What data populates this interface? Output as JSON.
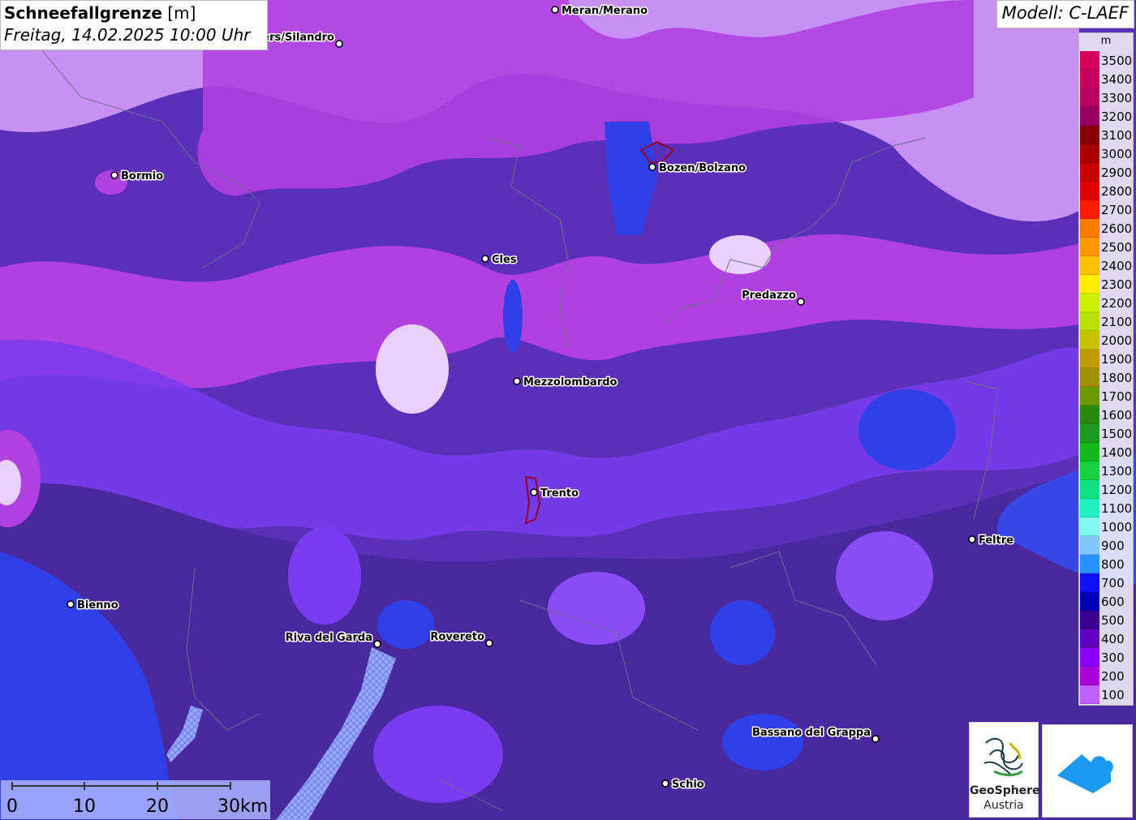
{
  "title": {
    "main_bold": "Schneefallgrenze",
    "main_unit": " [m]",
    "datetime": "Freitag, 14.02.2025 10:00 Uhr"
  },
  "model_label": "Modell: C-LAEF",
  "legend": {
    "unit": "m",
    "entries": [
      {
        "label": "3500",
        "color": "#d4005a"
      },
      {
        "label": "3400",
        "color": "#c8005e"
      },
      {
        "label": "3300",
        "color": "#b80064"
      },
      {
        "label": "3200",
        "color": "#9a0060"
      },
      {
        "label": "3100",
        "color": "#8a0000"
      },
      {
        "label": "3000",
        "color": "#a80000"
      },
      {
        "label": "2900",
        "color": "#c80000"
      },
      {
        "label": "2800",
        "color": "#e00000"
      },
      {
        "label": "2700",
        "color": "#ff1a00"
      },
      {
        "label": "2600",
        "color": "#ff7a00"
      },
      {
        "label": "2500",
        "color": "#ff9900"
      },
      {
        "label": "2400",
        "color": "#ffc000"
      },
      {
        "label": "2300",
        "color": "#ffee00"
      },
      {
        "label": "2200",
        "color": "#c8f000"
      },
      {
        "label": "2100",
        "color": "#b8e000"
      },
      {
        "label": "2000",
        "color": "#c8c000"
      },
      {
        "label": "1900",
        "color": "#c09a00"
      },
      {
        "label": "1800",
        "color": "#a09000"
      },
      {
        "label": "1700",
        "color": "#6a9a00"
      },
      {
        "label": "1600",
        "color": "#2a8a10"
      },
      {
        "label": "1500",
        "color": "#1a9a20"
      },
      {
        "label": "1400",
        "color": "#10b818"
      },
      {
        "label": "1300",
        "color": "#18d040"
      },
      {
        "label": "1200",
        "color": "#10e080"
      },
      {
        "label": "1100",
        "color": "#20f0c0"
      },
      {
        "label": "1000",
        "color": "#80f8f0"
      },
      {
        "label": "900",
        "color": "#80c8ff"
      },
      {
        "label": "800",
        "color": "#2890ff"
      },
      {
        "label": "700",
        "color": "#1010ff"
      },
      {
        "label": "600",
        "color": "#0000b8"
      },
      {
        "label": "500",
        "color": "#3a0090"
      },
      {
        "label": "400",
        "color": "#6000c0"
      },
      {
        "label": "300",
        "color": "#8a00ff"
      },
      {
        "label": "200",
        "color": "#a800d8"
      },
      {
        "label": "100",
        "color": "#c060ff"
      }
    ]
  },
  "cities": [
    {
      "name": "Meran/Merano"
    },
    {
      "name": "ers/Silandro"
    },
    {
      "name": "Bormio"
    },
    {
      "name": "Bozen/Bolzano"
    },
    {
      "name": "Cles"
    },
    {
      "name": "Predazzo"
    },
    {
      "name": "Mezzolombardo"
    },
    {
      "name": "Trento"
    },
    {
      "name": "Feltre"
    },
    {
      "name": "Bienno"
    },
    {
      "name": "Riva del Garda"
    },
    {
      "name": "Rovereto"
    },
    {
      "name": "Bassano del Grappa"
    },
    {
      "name": "Schio"
    }
  ],
  "scale_bar": {
    "labels": [
      "0",
      "10",
      "20",
      "30km"
    ]
  },
  "logo": {
    "line1": "GeoSphere",
    "line2": "Austria"
  },
  "colors": {
    "deep_violet": "#5a2fb0",
    "violet": "#7a3cf0",
    "magenta": "#b440e8",
    "lilac": "#c890f5",
    "blue": "#3040e8"
  }
}
